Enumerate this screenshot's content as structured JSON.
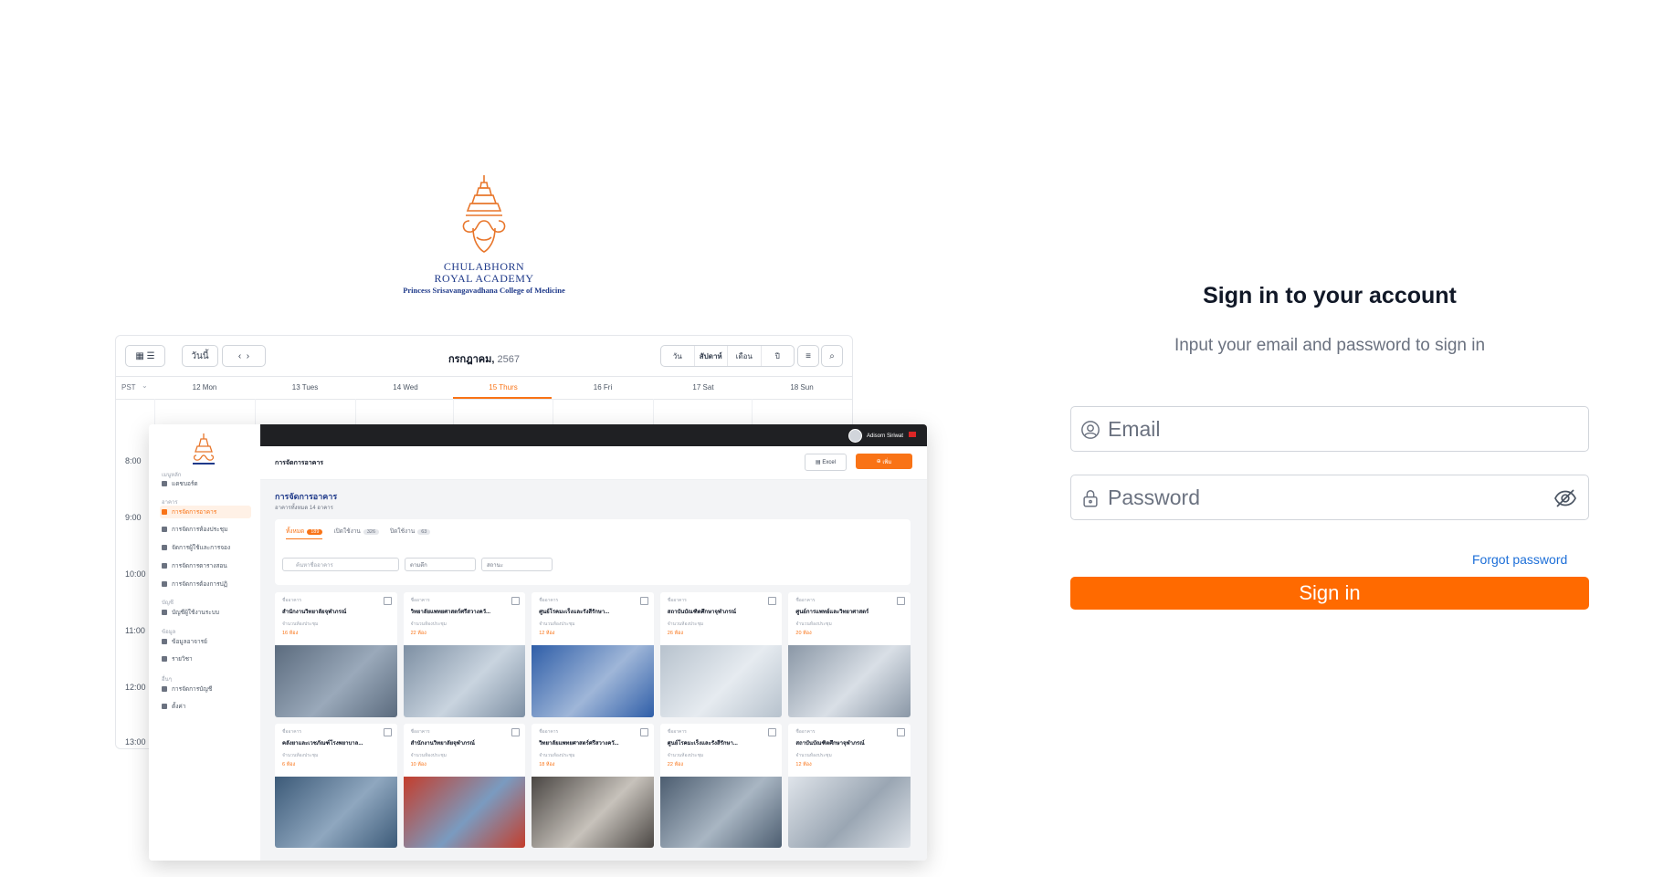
{
  "logo": {
    "line1": "CHULABHORN",
    "line2": "ROYAL ACADEMY",
    "line3": "Princess Srisavangavadhana College of Medicine"
  },
  "preview": {
    "calendar": {
      "today_btn": "วันนี้",
      "title_month": "กรกฎาคม,",
      "title_year": "2567",
      "view_day": "วัน",
      "view_week": "สัปดาห์",
      "view_month": "เดือน",
      "view_year": "ปี",
      "timezone": "PST",
      "days": [
        "12 Mon",
        "13 Tues",
        "14 Wed",
        "15 Thurs",
        "16 Fri",
        "17 Sat",
        "18 Sun"
      ],
      "times": [
        "8:00",
        "9:00",
        "10:00",
        "11:00",
        "12:00",
        "13:00"
      ]
    },
    "app": {
      "user_name": "Adisorn Siriwat",
      "topbar_title": "การจัดการอาคาร",
      "excel_btn": "Excel",
      "add_btn": "เพิ่ม",
      "page_title": "การจัดการอาคาร",
      "page_subtitle": "อาคารทั้งหมด 14 อาคาร",
      "tabs": [
        {
          "label": "ทั้งหมด",
          "count": "189"
        },
        {
          "label": "เปิดใช้งาน",
          "count": "326"
        },
        {
          "label": "ปิดใช้งาน",
          "count": "63"
        }
      ],
      "search_placeholder": "ค้นหาชื่ออาคาร",
      "filter1": "ตามตึก",
      "filter2": "สถานะ",
      "sidebar": {
        "sec1": "เมนูหลัก",
        "item1": "แดชบอร์ด",
        "sec2": "อาคาร",
        "item2": "การจัดการอาคาร",
        "item3": "การจัดการห้องประชุม",
        "item4": "จัดการผู้ใช้และการจอง",
        "item5": "การจัดการตารางสอน",
        "item6": "การจัดการต้องการปฏิ",
        "sec3": "บัญชี",
        "item7": "บัญชีผู้ใช้งานระบบ",
        "sec4": "ข้อมูล",
        "item8": "ข้อมูลอาจารย์",
        "item9": "รายวิชา",
        "sec5": "อื่นๆ",
        "item10": "การจัดการบัญชี",
        "item11": "ตั้งค่า"
      },
      "cards": [
        {
          "type": "ชื่ออาคาร",
          "name": "สำนักงานวิทยาลัยจุฬาภรณ์",
          "sub": "จำนวนห้องประชุม",
          "rooms": "16 ห้อง"
        },
        {
          "type": "ชื่ออาคาร",
          "name": "วิทยาลัยแพทยศาสตร์ศรีสวางควั...",
          "sub": "จำนวนห้องประชุม",
          "rooms": "22 ห้อง"
        },
        {
          "type": "ชื่ออาคาร",
          "name": "ศูนย์โรคมะเร็งและรังสีรักษา...",
          "sub": "จำนวนห้องประชุม",
          "rooms": "12 ห้อง"
        },
        {
          "type": "ชื่ออาคาร",
          "name": "สถาบันบัณฑิตศึกษาจุฬาภรณ์",
          "sub": "จำนวนห้องประชุม",
          "rooms": "26 ห้อง"
        },
        {
          "type": "ชื่ออาคาร",
          "name": "ศูนย์การแพทย์และวิทยาศาสตร์",
          "sub": "จำนวนห้องประชุม",
          "rooms": "20 ห้อง"
        },
        {
          "type": "ชื่ออาคาร",
          "name": "คลังยาและเวชภัณฑ์โรงพยาบาล...",
          "sub": "จำนวนห้องประชุม",
          "rooms": "6 ห้อง"
        },
        {
          "type": "ชื่ออาคาร",
          "name": "สำนักงานวิทยาลัยจุฬาภรณ์",
          "sub": "จำนวนห้องประชุม",
          "rooms": "10 ห้อง"
        },
        {
          "type": "ชื่ออาคาร",
          "name": "วิทยาลัยแพทยศาสตร์ศรีสวางควั...",
          "sub": "จำนวนห้องประชุม",
          "rooms": "18 ห้อง"
        },
        {
          "type": "ชื่ออาคาร",
          "name": "ศูนย์โรคมะเร็งและรังสีรักษา...",
          "sub": "จำนวนห้องประชุม",
          "rooms": "22 ห้อง"
        },
        {
          "type": "ชื่ออาคาร",
          "name": "สถาบันบัณฑิตศึกษาจุฬาภรณ์",
          "sub": "จำนวนห้องประชุม",
          "rooms": "12 ห้อง"
        }
      ]
    }
  },
  "signin": {
    "title": "Sign in to your account",
    "subtitle": "Input your email and password to sign in",
    "email_placeholder": "Email",
    "password_placeholder": "Password",
    "forgot_label": "Forgot password",
    "button_label": "Sign in"
  },
  "icons": {
    "email": "user-circle-icon",
    "password": "lock-icon",
    "toggle": "eye-off-icon"
  },
  "colors": {
    "accent": "#ff6a00",
    "link": "#1d6fd8",
    "brand_blue": "#1f3a8a"
  }
}
